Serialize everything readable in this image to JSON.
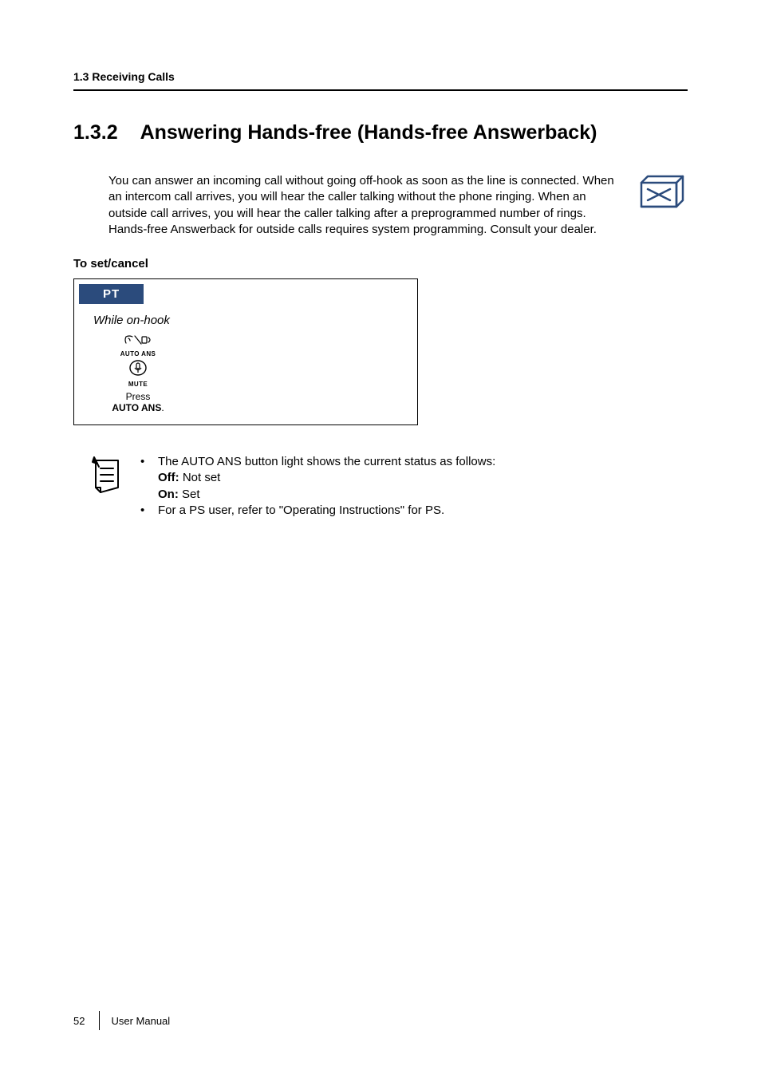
{
  "header": {
    "running": "1.3 Receiving Calls"
  },
  "section": {
    "number": "1.3.2",
    "title": "Answering Hands-free (Hands-free Answerback)"
  },
  "intro": "You can answer an incoming call without going off-hook as soon as the line is connected. When an intercom call arrives, you will hear the caller talking without the phone ringing. When an outside call arrives, you will hear the caller talking after a preprogrammed number of rings. Hands-free Answerback for outside calls requires system programming. Consult your dealer.",
  "procedure": {
    "heading": "To set/cancel",
    "tab": "PT",
    "state": "While on-hook",
    "auto_ans_label": "AUTO ANS",
    "mute_label": "MUTE",
    "press_word": "Press",
    "press_target": "AUTO ANS",
    "press_suffix": "."
  },
  "notes": {
    "item1_lead": "The AUTO ANS button light shows the current status as follows:",
    "off_label": "Off:",
    "off_value": "Not set",
    "on_label": "On:",
    "on_value": "Set",
    "item2": "For a PS user, refer to \"Operating Instructions\" for PS."
  },
  "footer": {
    "page": "52",
    "doc": "User Manual"
  }
}
